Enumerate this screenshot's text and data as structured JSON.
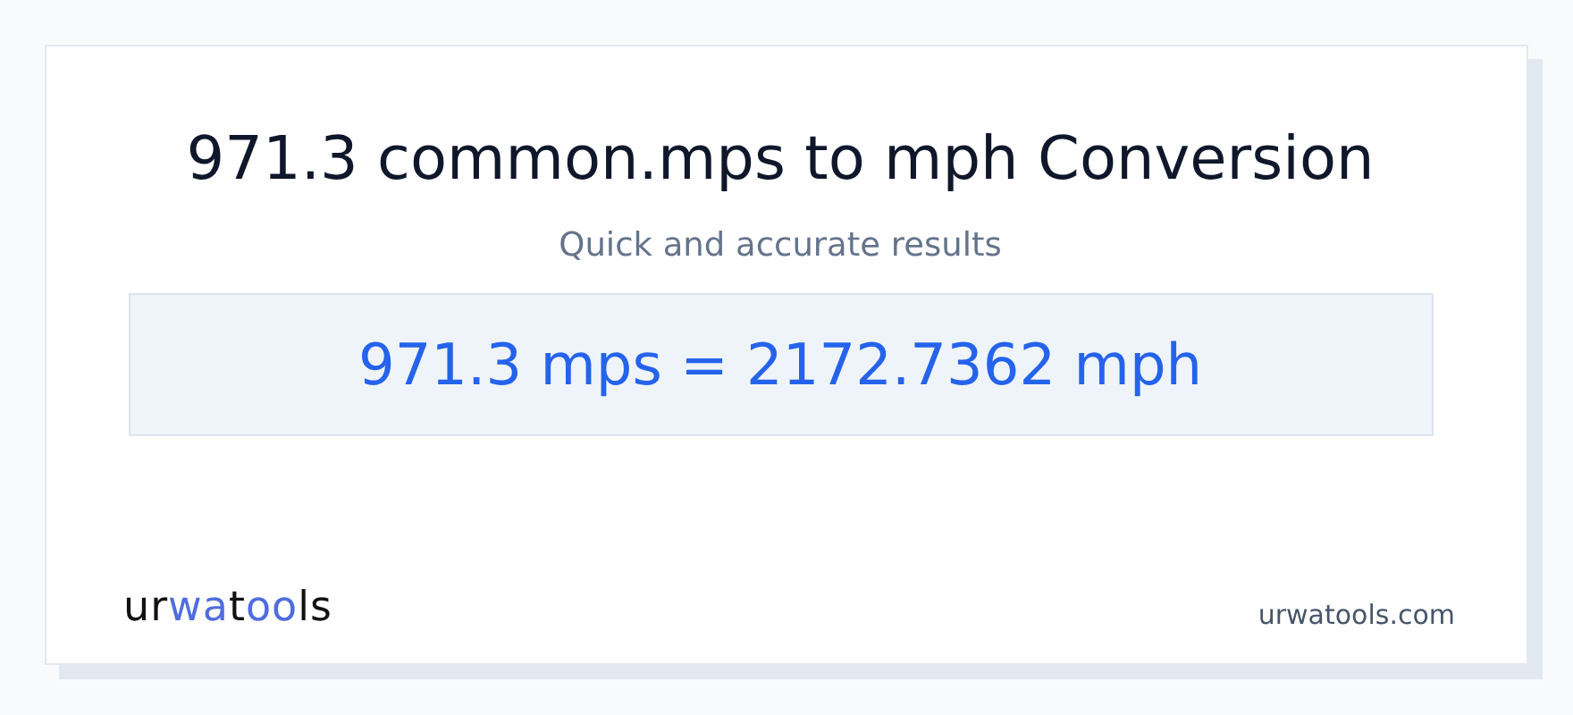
{
  "title": "971.3 common.mps to mph Conversion",
  "subtitle": "Quick and accurate results",
  "result": "971.3 mps = 2172.7362 mph",
  "footer": {
    "logo": [
      {
        "text": "ur",
        "accent": false
      },
      {
        "text": "wa",
        "accent": true
      },
      {
        "text": "t",
        "accent": false
      },
      {
        "text": "oo",
        "accent": true
      },
      {
        "text": "ls",
        "accent": false
      }
    ],
    "site": "urwatools.com"
  }
}
